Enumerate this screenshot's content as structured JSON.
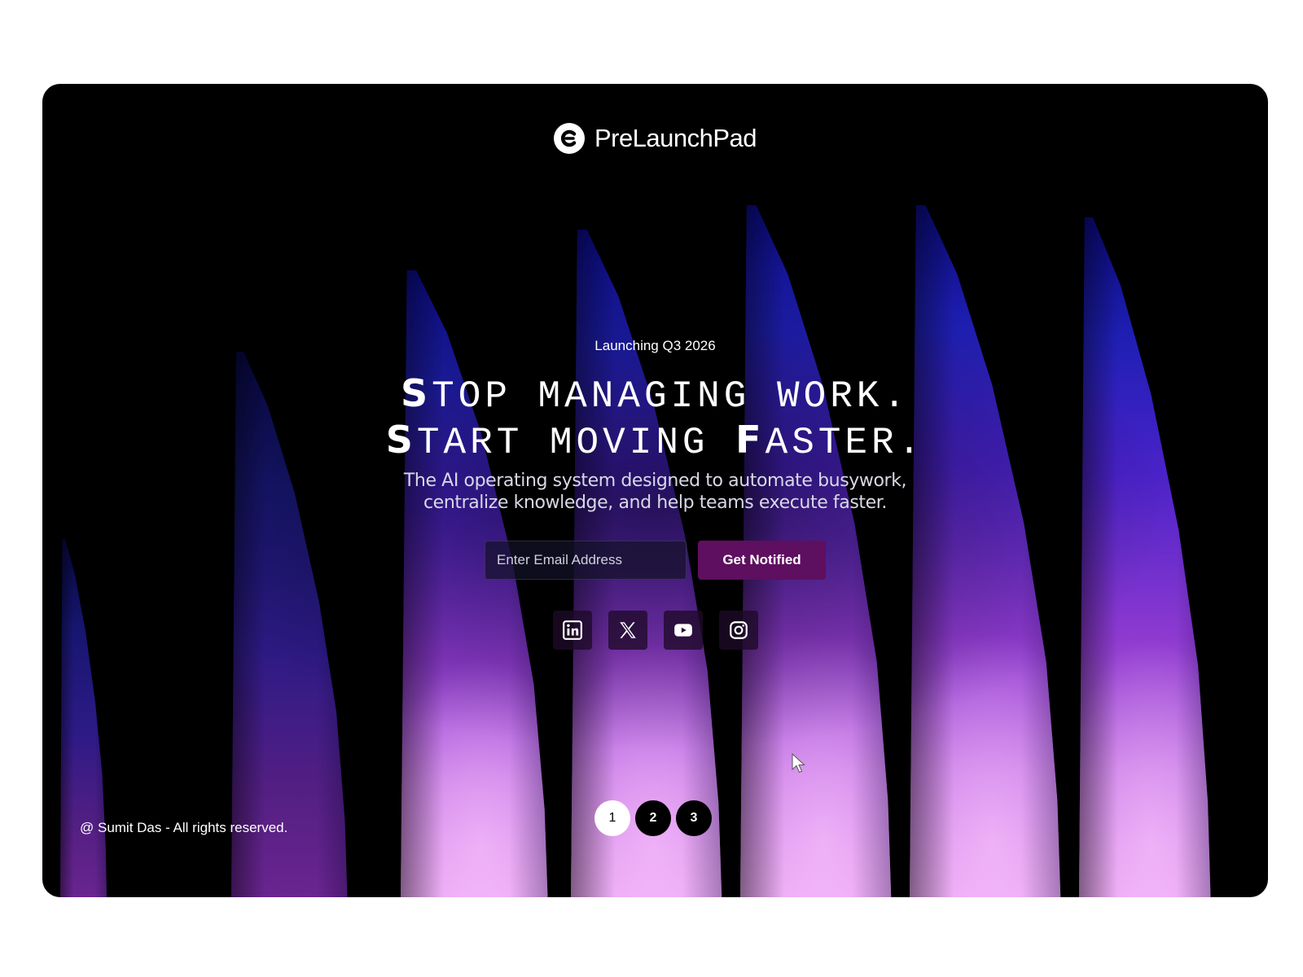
{
  "brand": {
    "name": "PreLaunchPad",
    "logo_icon": "prelaunchpad-logo-icon"
  },
  "hero": {
    "badge": "Launching Q3 2026",
    "headline_line1_first": "S",
    "headline_line1_rest": "TOP MANAGING WORK.",
    "headline_line2_first": "S",
    "headline_line2_mid": "TART MOVING ",
    "headline_line2_f": "F",
    "headline_line2_rest": "ASTER.",
    "subtitle_line1": "The AI operating system designed to automate busywork,",
    "subtitle_line2": "centralize knowledge, and help teams execute faster."
  },
  "signup": {
    "email_placeholder": "Enter Email Address",
    "email_value": "",
    "button_label": "Get Notified",
    "button_color": "#5e0f5f"
  },
  "socials": [
    {
      "name": "LinkedIn",
      "icon": "linkedin-icon"
    },
    {
      "name": "X",
      "icon": "x-icon"
    },
    {
      "name": "YouTube",
      "icon": "youtube-icon"
    },
    {
      "name": "Instagram",
      "icon": "instagram-icon"
    }
  ],
  "footer": {
    "copyright": "@ Sumit Das - All rights reserved."
  },
  "pagination": {
    "pages": [
      "1",
      "2",
      "3"
    ],
    "active_page": "1"
  },
  "colors": {
    "background": "#000000",
    "page_background": "#ffffff",
    "beam_top": "#0a0a7a",
    "beam_bottom": "#e9a5f3",
    "accent": "#5e0f5f"
  }
}
